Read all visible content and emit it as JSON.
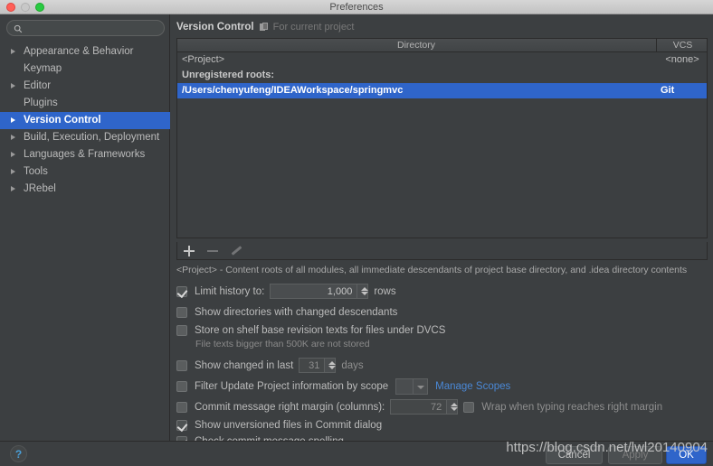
{
  "window": {
    "title": "Preferences",
    "controls": {
      "close": "close",
      "minimize": "minimize",
      "zoom": "zoom"
    }
  },
  "sidebar": {
    "search": {
      "value": "",
      "placeholder": ""
    },
    "items": [
      {
        "label": "Appearance & Behavior",
        "expandable": true,
        "selected": false
      },
      {
        "label": "Keymap",
        "expandable": false,
        "selected": false
      },
      {
        "label": "Editor",
        "expandable": true,
        "selected": false
      },
      {
        "label": "Plugins",
        "expandable": false,
        "selected": false
      },
      {
        "label": "Version Control",
        "expandable": true,
        "selected": true
      },
      {
        "label": "Build, Execution, Deployment",
        "expandable": true,
        "selected": false
      },
      {
        "label": "Languages & Frameworks",
        "expandable": true,
        "selected": false
      },
      {
        "label": "Tools",
        "expandable": true,
        "selected": false
      },
      {
        "label": "JRebel",
        "expandable": true,
        "selected": false
      }
    ]
  },
  "page": {
    "title": "Version Control",
    "subtitle": "For current project",
    "table": {
      "columns": [
        "Directory",
        "VCS"
      ],
      "rows": [
        {
          "directory": "<Project>",
          "vcs": "<none>",
          "kind": "entry",
          "selected": false
        },
        {
          "directory": "Unregistered roots:",
          "vcs": "",
          "kind": "section",
          "selected": false
        },
        {
          "directory": "/Users/chenyufeng/IDEAWorkspace/springmvc",
          "vcs": "Git",
          "kind": "entry",
          "selected": true
        }
      ]
    },
    "toolbar": {
      "add_label": "+",
      "remove_label": "−",
      "edit_label": "edit",
      "add_enabled": true,
      "remove_enabled": false,
      "edit_enabled": false
    },
    "description": "<Project> - Content roots of all modules, all immediate descendants of project base directory, and .idea directory contents",
    "options": {
      "limit_history": {
        "label": "Limit history to:",
        "checked": true,
        "value": "1,000",
        "suffix": "rows"
      },
      "show_dirs_changed": {
        "label": "Show directories with changed descendants",
        "checked": false
      },
      "store_on_shelf": {
        "label": "Store on shelf base revision texts for files under DVCS",
        "checked": false,
        "hint": "File texts bigger than 500K are not stored"
      },
      "show_changed_last": {
        "label": "Show changed in last",
        "checked": false,
        "value": "31",
        "suffix": "days"
      },
      "filter_by_scope": {
        "label": "Filter Update Project information by scope",
        "checked": false,
        "scope_value": "",
        "manage_link": "Manage Scopes"
      },
      "commit_margin": {
        "label": "Commit message right margin (columns):",
        "checked": false,
        "value": "72",
        "wrap_label": "Wrap when typing reaches right margin",
        "wrap_checked": false
      },
      "show_unversioned": {
        "label": "Show unversioned files in Commit dialog",
        "checked": true
      },
      "check_spelling": {
        "label": "Check commit message spelling",
        "checked": true
      }
    }
  },
  "footer": {
    "help_label": "?",
    "cancel_label": "Cancel",
    "apply_label": "Apply",
    "ok_label": "OK"
  },
  "watermark": "https://blog.csdn.net/lwl20140904",
  "colors": {
    "accent": "#2f65ca",
    "background": "#3c3f41",
    "link": "#4a88d6",
    "text": "#bbbbbb"
  }
}
